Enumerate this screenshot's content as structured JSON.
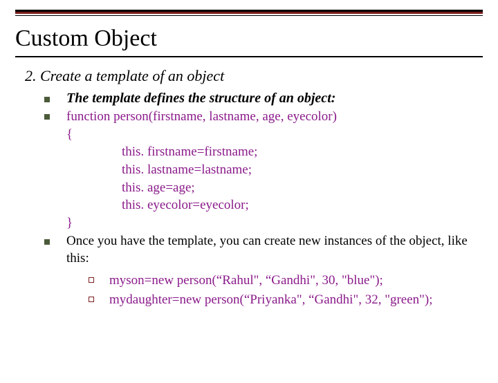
{
  "title": "Custom Object",
  "section": {
    "heading": "2. Create a template of an object",
    "items": [
      {
        "text": "The template defines the structure of an object:"
      },
      {
        "code": {
          "line1": "function person(firstname, lastname, age, eyecolor)",
          "line2": "{",
          "body1": "this. firstname=firstname;",
          "body2": "this. lastname=lastname;",
          "body3": "this. age=age;",
          "body4": "this. eyecolor=eyecolor;",
          "line3": "}"
        }
      },
      {
        "text": "Once you have the template, you can create new instances of the object, like this:",
        "subitems": [
          "myson=new person(“Rahul\", “Gandhi\", 30, \"blue\");",
          "mydaughter=new person(“Priyanka\", “Gandhi\", 32, \"green\");"
        ]
      }
    ]
  }
}
